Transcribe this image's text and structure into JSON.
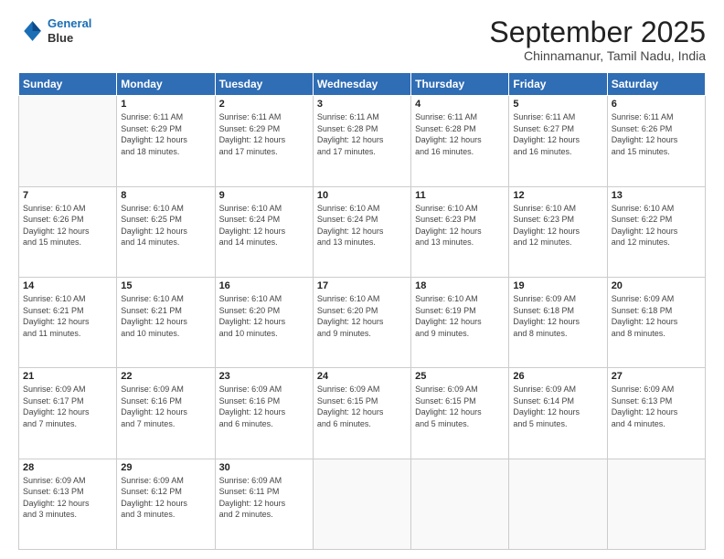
{
  "logo": {
    "line1": "General",
    "line2": "Blue"
  },
  "title": "September 2025",
  "location": "Chinnamanur, Tamil Nadu, India",
  "days_of_week": [
    "Sunday",
    "Monday",
    "Tuesday",
    "Wednesday",
    "Thursday",
    "Friday",
    "Saturday"
  ],
  "weeks": [
    [
      {
        "day": "",
        "info": ""
      },
      {
        "day": "1",
        "info": "Sunrise: 6:11 AM\nSunset: 6:29 PM\nDaylight: 12 hours\nand 18 minutes."
      },
      {
        "day": "2",
        "info": "Sunrise: 6:11 AM\nSunset: 6:29 PM\nDaylight: 12 hours\nand 17 minutes."
      },
      {
        "day": "3",
        "info": "Sunrise: 6:11 AM\nSunset: 6:28 PM\nDaylight: 12 hours\nand 17 minutes."
      },
      {
        "day": "4",
        "info": "Sunrise: 6:11 AM\nSunset: 6:28 PM\nDaylight: 12 hours\nand 16 minutes."
      },
      {
        "day": "5",
        "info": "Sunrise: 6:11 AM\nSunset: 6:27 PM\nDaylight: 12 hours\nand 16 minutes."
      },
      {
        "day": "6",
        "info": "Sunrise: 6:11 AM\nSunset: 6:26 PM\nDaylight: 12 hours\nand 15 minutes."
      }
    ],
    [
      {
        "day": "7",
        "info": "Sunrise: 6:10 AM\nSunset: 6:26 PM\nDaylight: 12 hours\nand 15 minutes."
      },
      {
        "day": "8",
        "info": "Sunrise: 6:10 AM\nSunset: 6:25 PM\nDaylight: 12 hours\nand 14 minutes."
      },
      {
        "day": "9",
        "info": "Sunrise: 6:10 AM\nSunset: 6:24 PM\nDaylight: 12 hours\nand 14 minutes."
      },
      {
        "day": "10",
        "info": "Sunrise: 6:10 AM\nSunset: 6:24 PM\nDaylight: 12 hours\nand 13 minutes."
      },
      {
        "day": "11",
        "info": "Sunrise: 6:10 AM\nSunset: 6:23 PM\nDaylight: 12 hours\nand 13 minutes."
      },
      {
        "day": "12",
        "info": "Sunrise: 6:10 AM\nSunset: 6:23 PM\nDaylight: 12 hours\nand 12 minutes."
      },
      {
        "day": "13",
        "info": "Sunrise: 6:10 AM\nSunset: 6:22 PM\nDaylight: 12 hours\nand 12 minutes."
      }
    ],
    [
      {
        "day": "14",
        "info": "Sunrise: 6:10 AM\nSunset: 6:21 PM\nDaylight: 12 hours\nand 11 minutes."
      },
      {
        "day": "15",
        "info": "Sunrise: 6:10 AM\nSunset: 6:21 PM\nDaylight: 12 hours\nand 10 minutes."
      },
      {
        "day": "16",
        "info": "Sunrise: 6:10 AM\nSunset: 6:20 PM\nDaylight: 12 hours\nand 10 minutes."
      },
      {
        "day": "17",
        "info": "Sunrise: 6:10 AM\nSunset: 6:20 PM\nDaylight: 12 hours\nand 9 minutes."
      },
      {
        "day": "18",
        "info": "Sunrise: 6:10 AM\nSunset: 6:19 PM\nDaylight: 12 hours\nand 9 minutes."
      },
      {
        "day": "19",
        "info": "Sunrise: 6:09 AM\nSunset: 6:18 PM\nDaylight: 12 hours\nand 8 minutes."
      },
      {
        "day": "20",
        "info": "Sunrise: 6:09 AM\nSunset: 6:18 PM\nDaylight: 12 hours\nand 8 minutes."
      }
    ],
    [
      {
        "day": "21",
        "info": "Sunrise: 6:09 AM\nSunset: 6:17 PM\nDaylight: 12 hours\nand 7 minutes."
      },
      {
        "day": "22",
        "info": "Sunrise: 6:09 AM\nSunset: 6:16 PM\nDaylight: 12 hours\nand 7 minutes."
      },
      {
        "day": "23",
        "info": "Sunrise: 6:09 AM\nSunset: 6:16 PM\nDaylight: 12 hours\nand 6 minutes."
      },
      {
        "day": "24",
        "info": "Sunrise: 6:09 AM\nSunset: 6:15 PM\nDaylight: 12 hours\nand 6 minutes."
      },
      {
        "day": "25",
        "info": "Sunrise: 6:09 AM\nSunset: 6:15 PM\nDaylight: 12 hours\nand 5 minutes."
      },
      {
        "day": "26",
        "info": "Sunrise: 6:09 AM\nSunset: 6:14 PM\nDaylight: 12 hours\nand 5 minutes."
      },
      {
        "day": "27",
        "info": "Sunrise: 6:09 AM\nSunset: 6:13 PM\nDaylight: 12 hours\nand 4 minutes."
      }
    ],
    [
      {
        "day": "28",
        "info": "Sunrise: 6:09 AM\nSunset: 6:13 PM\nDaylight: 12 hours\nand 3 minutes."
      },
      {
        "day": "29",
        "info": "Sunrise: 6:09 AM\nSunset: 6:12 PM\nDaylight: 12 hours\nand 3 minutes."
      },
      {
        "day": "30",
        "info": "Sunrise: 6:09 AM\nSunset: 6:11 PM\nDaylight: 12 hours\nand 2 minutes."
      },
      {
        "day": "",
        "info": ""
      },
      {
        "day": "",
        "info": ""
      },
      {
        "day": "",
        "info": ""
      },
      {
        "day": "",
        "info": ""
      }
    ]
  ]
}
